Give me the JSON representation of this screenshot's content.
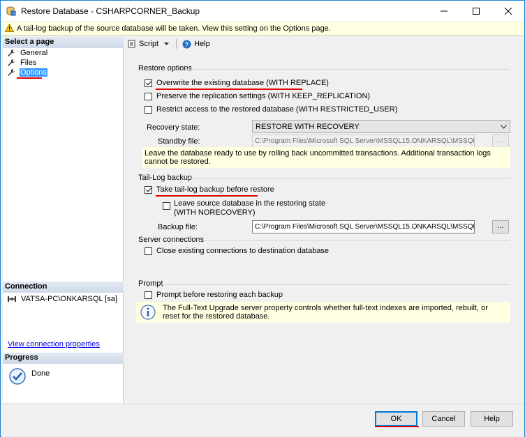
{
  "window": {
    "title": "Restore Database - CSHARPCORNER_Backup"
  },
  "warning": {
    "text": "A tail-log backup of the source database will be taken. View this setting on the Options page."
  },
  "left": {
    "select_page_header": "Select a page",
    "pages": [
      {
        "label": "General"
      },
      {
        "label": "Files"
      },
      {
        "label": "Options"
      }
    ],
    "connection_header": "Connection",
    "connection": "VATSA-PC\\ONKARSQL [sa]",
    "view_connection_link": "View connection properties",
    "progress_header": "Progress",
    "progress_status": "Done"
  },
  "toolbar": {
    "script_label": "Script",
    "help_label": "Help"
  },
  "restore_options": {
    "title": "Restore options",
    "overwrite": "Overwrite the existing database (WITH REPLACE)",
    "preserve": "Preserve the replication settings (WITH KEEP_REPLICATION)",
    "restrict": "Restrict access to the restored database (WITH RESTRICTED_USER)",
    "recovery_state_label": "Recovery state:",
    "recovery_state_value": "RESTORE WITH RECOVERY",
    "standby_label": "Standby file:",
    "standby_value": "C:\\Program Files\\Microsoft SQL Server\\MSSQL15.ONKARSQL\\MSSQL\\Bac",
    "recovery_info": "Leave the database ready to use by rolling back uncommitted transactions. Additional transaction logs cannot be restored."
  },
  "tail_log": {
    "title": "Tail-Log backup",
    "take_backup": "Take tail-log backup before restore",
    "leave_source_line1": "Leave source database in the restoring state",
    "leave_source_line2": "(WITH NORECOVERY)",
    "backup_file_label": "Backup file:",
    "backup_file_value": "C:\\Program Files\\Microsoft SQL Server\\MSSQL15.ONKARSQL\\MSSQL\\Bac"
  },
  "server_connections": {
    "title": "Server connections",
    "close_existing": "Close existing connections to destination database"
  },
  "prompt": {
    "title": "Prompt",
    "prompt_before": "Prompt before restoring each backup",
    "fulltext_info": "The Full-Text Upgrade server property controls whether full-text indexes are imported, rebuilt, or reset for the restored database."
  },
  "buttons": {
    "ok": "OK",
    "cancel": "Cancel",
    "help": "Help",
    "ellipsis": "..."
  },
  "colors": {
    "accent": "#0078d7",
    "selection": "#3399ff",
    "annotation": "#e00000",
    "info_bg": "#ffffe1"
  }
}
